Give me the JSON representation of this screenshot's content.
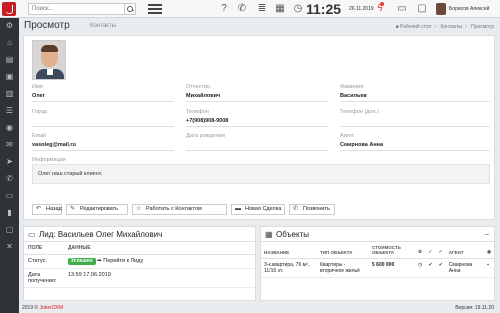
{
  "topbar": {
    "search_placeholder": "Поиск...",
    "time": "11:25",
    "date": "26.11.2019",
    "user_name": "Борисов Алексей"
  },
  "header": {
    "title": "Просмотр",
    "subtitle": "Контакты",
    "breadcrumbs": [
      "Рабочий стол",
      "Контакты",
      "Просмотр"
    ]
  },
  "contact": {
    "fields": {
      "first_name": {
        "label": "Имя",
        "value": "Олег"
      },
      "patronymic": {
        "label": "Отчество",
        "value": "Михайлович"
      },
      "last_name": {
        "label": "Фамилия",
        "value": "Васильев"
      },
      "city": {
        "label": "Город",
        "value": ""
      },
      "phone": {
        "label": "Телефон",
        "value": "+7(908)908-9008"
      },
      "phone_extra": {
        "label": "Телефон (доп.)",
        "value": ""
      },
      "email": {
        "label": "Email",
        "value": "vasoleg@mail.ru"
      },
      "birthday": {
        "label": "Дата рождения",
        "value": ""
      },
      "agent": {
        "label": "Агент",
        "value": "Смирнова Анна"
      }
    },
    "info_label": "Информация",
    "info_text": "Олег наш старый клиент."
  },
  "actions": {
    "back": "Назад",
    "edit": "Редактировать",
    "work": "Работать с Контактом",
    "new_deal": "Новая Сделка",
    "call": "Позвонить"
  },
  "lead_panel": {
    "title": "Лид: Васильев Олег Михайлович",
    "col_field": "ПОЛЕ",
    "col_data": "ДАННЫЕ",
    "rows": [
      {
        "field": "Статус:",
        "badge": "Успешно",
        "link": "Перейти к Лиду"
      },
      {
        "field": "Дата получения:",
        "value": "13:59 17.06.2019"
      }
    ]
  },
  "objects_panel": {
    "title": "Объекты",
    "columns": [
      "НАЗВАНИЕ",
      "ТИП ОБЪЕКТА",
      "СТОИМОСТЬ ОБЪЕКТА",
      "АГЕНТ"
    ],
    "rows": [
      {
        "name": "3-к.квартира, 76 м², 11/16 эт.",
        "type": "Квартиры - вторичное жильё",
        "price": "5 600 000",
        "agent": "Смирнова Анна"
      }
    ]
  },
  "footer": {
    "copyright_prefix": "2019 © ",
    "brand": "JokerCRM",
    "version": "Версия: 19.11.20"
  },
  "colors": {
    "brand_red": "#c91d25",
    "sidebar": "#2f3338",
    "success_green": "#3fae49"
  }
}
